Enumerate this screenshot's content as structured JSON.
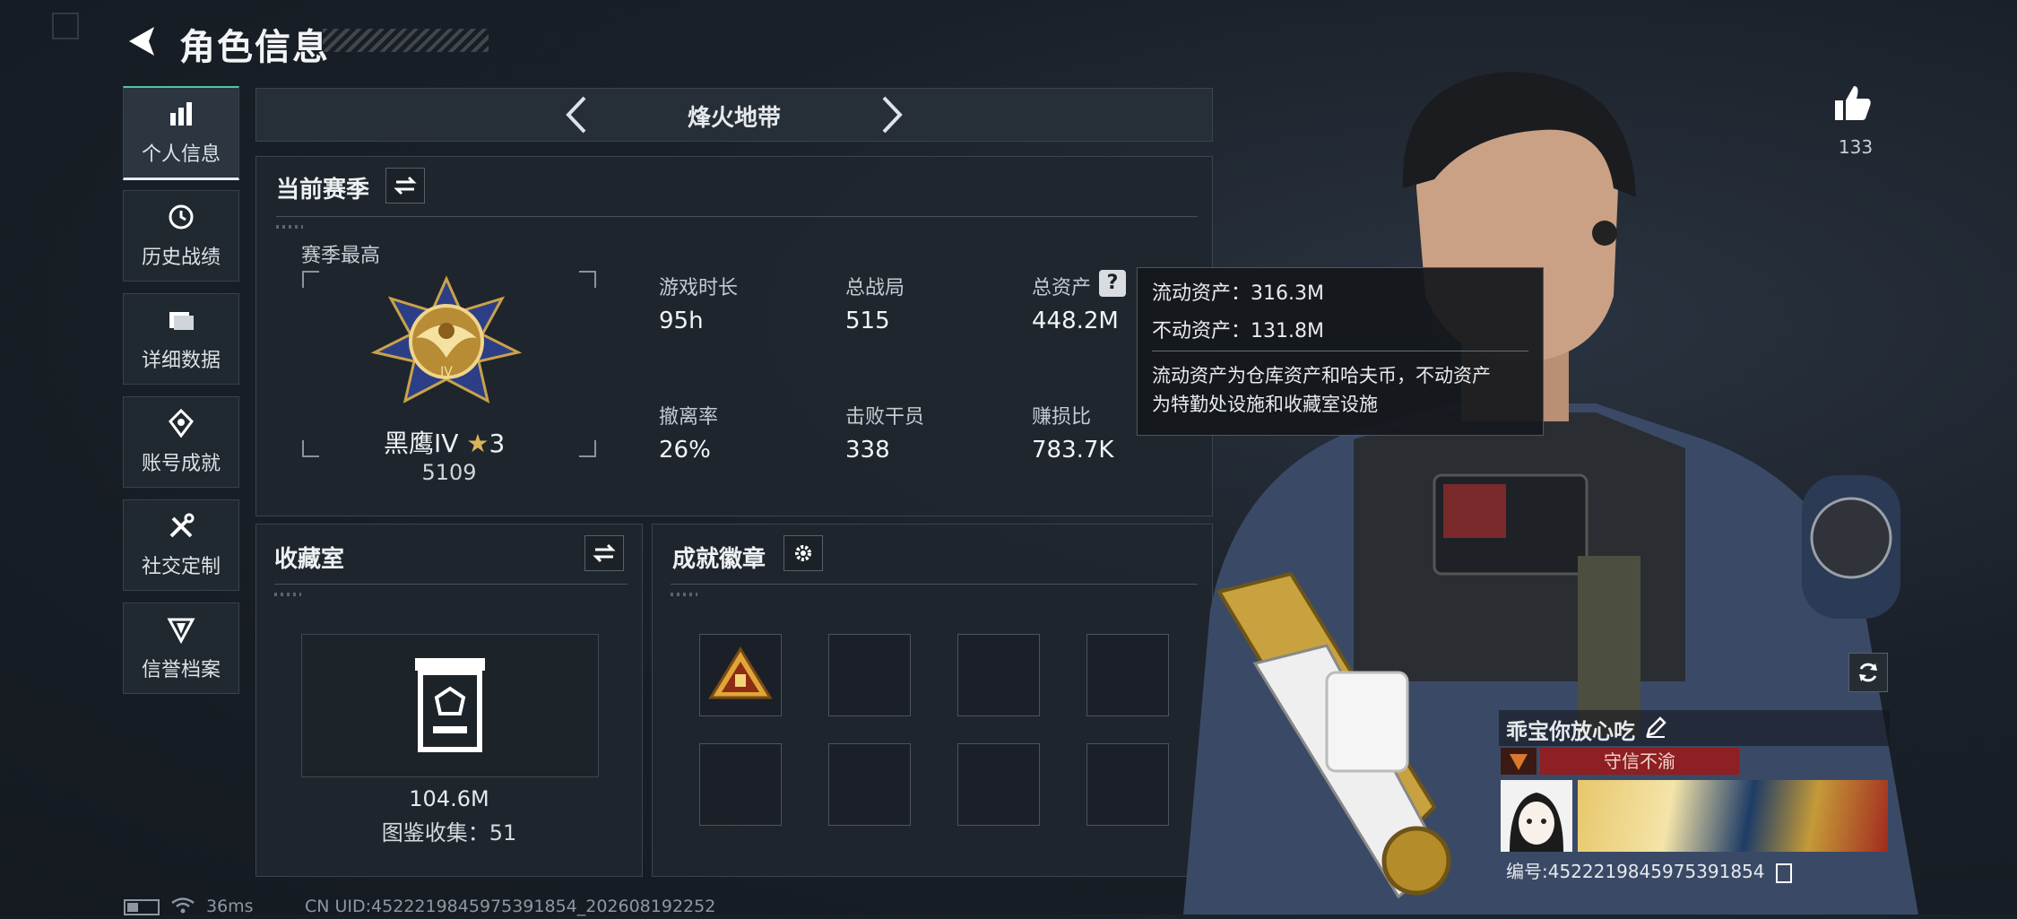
{
  "header": {
    "title": "角色信息"
  },
  "sidebar": {
    "items": [
      {
        "label": "个人信息",
        "icon": "bar-chart-icon",
        "active": true
      },
      {
        "label": "历史战绩",
        "icon": "history-icon",
        "active": false
      },
      {
        "label": "详细数据",
        "icon": "folder-icon",
        "active": false
      },
      {
        "label": "账号成就",
        "icon": "achievement-icon",
        "active": false
      },
      {
        "label": "社交定制",
        "icon": "tools-icon",
        "active": false
      },
      {
        "label": "信誉档案",
        "icon": "shield-icon",
        "active": false
      }
    ]
  },
  "mode_selector": {
    "label": "烽火地带"
  },
  "season": {
    "title": "当前赛季",
    "best_label": "赛季最高",
    "rank_name": "黑鹰IV",
    "rank_stars": "3",
    "rank_points": "5109",
    "stats": [
      {
        "label": "游戏时长",
        "value": "95h"
      },
      {
        "label": "总战局",
        "value": "515"
      },
      {
        "label": "总资产",
        "value": "448.2M"
      },
      {
        "label": "撤离率",
        "value": "26%"
      },
      {
        "label": "击败干员",
        "value": "338"
      },
      {
        "label": "赚损比",
        "value": "783.7K"
      }
    ]
  },
  "tooltip": {
    "liquid": "流动资产：316.3M",
    "fixed": "不动资产：131.8M",
    "note_line1": "流动资产为仓库资产和哈夫币，不动资产",
    "note_line2": "为特勤处设施和收藏室设施"
  },
  "collection": {
    "title": "收藏室",
    "value": "104.6M",
    "count_text": "图鉴收集：51"
  },
  "badges": {
    "title": "成就徽章"
  },
  "likes": {
    "count": "133"
  },
  "profile": {
    "name": "乖宝你放心吃",
    "reputation": "守信不渝",
    "id_text": "编号:4522219845975391854"
  },
  "status_bar": {
    "ping": "36ms",
    "uid": "CN UID:4522219845975391854_202608192252"
  },
  "colors": {
    "accent_green": "#4fc7a0",
    "reputation_red": "#8e1f22",
    "gold": "#c9a24a"
  }
}
